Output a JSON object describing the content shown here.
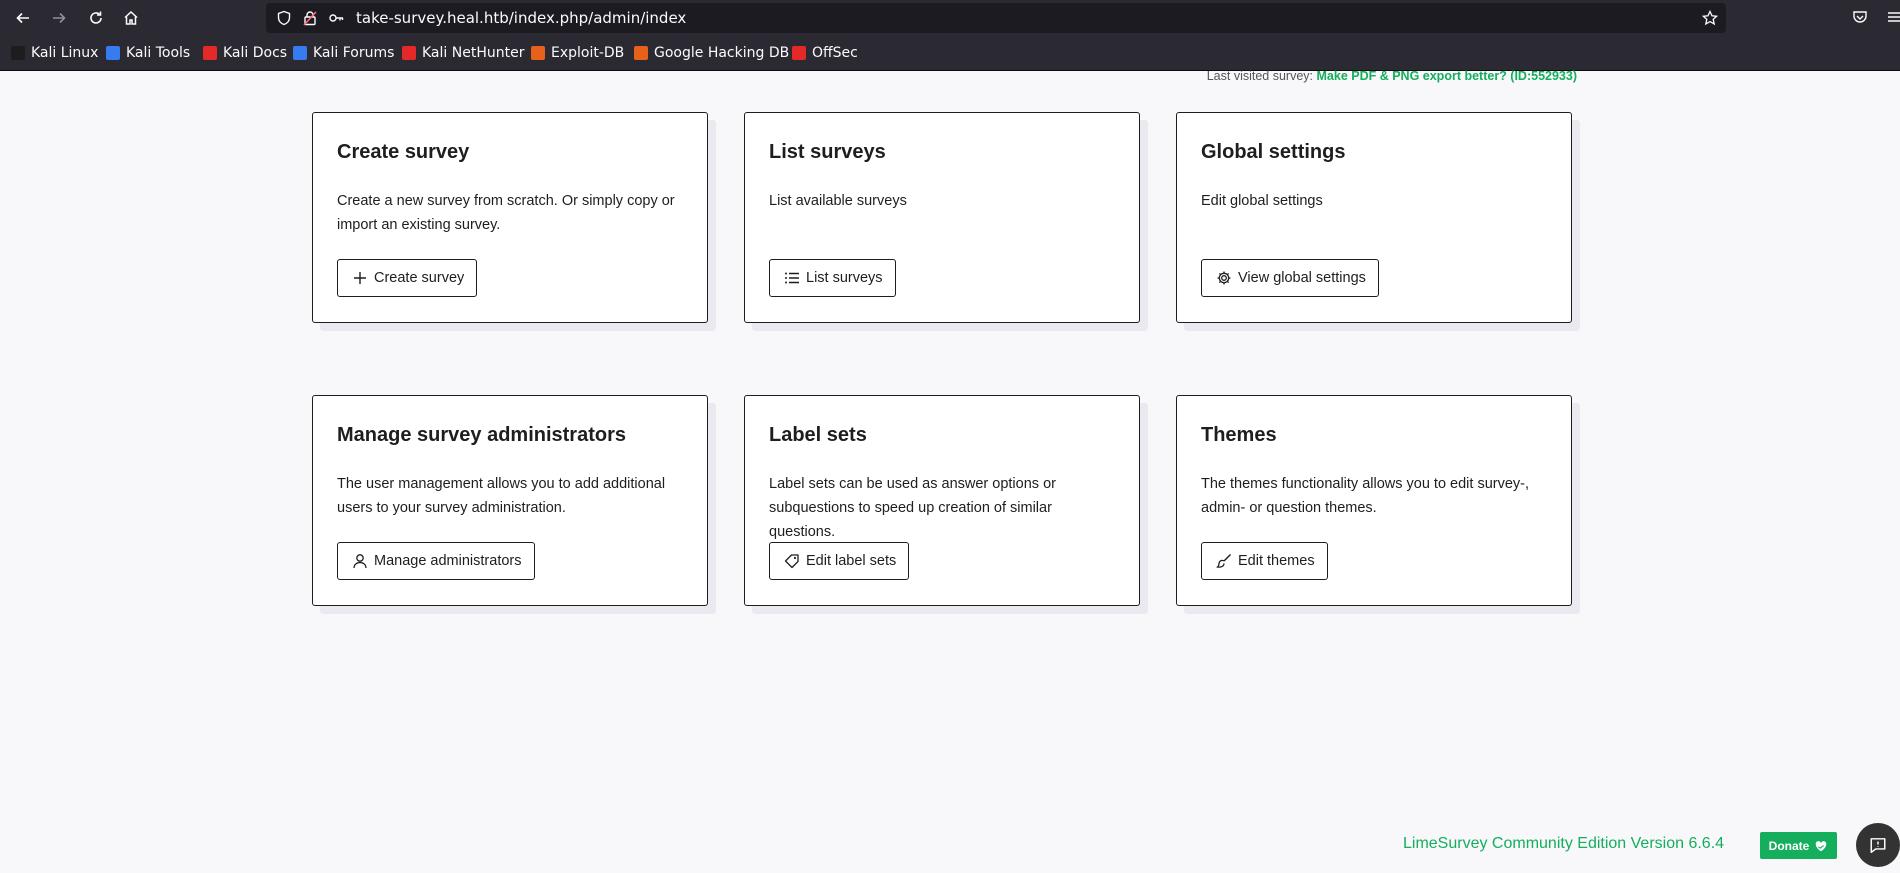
{
  "browser": {
    "url": "take-survey.heal.htb/index.php/admin/index",
    "bookmarks": [
      {
        "label": "Kali Linux",
        "color": "#1d1d1d"
      },
      {
        "label": "Kali Tools",
        "color": "#367bf0"
      },
      {
        "label": "Kali Docs",
        "color": "#e52929"
      },
      {
        "label": "Kali Forums",
        "color": "#367bf0"
      },
      {
        "label": "Kali NetHunter",
        "color": "#e52929"
      },
      {
        "label": "Exploit-DB",
        "color": "#e8611a"
      },
      {
        "label": "Google Hacking DB",
        "color": "#e8611a"
      },
      {
        "label": "OffSec",
        "color": "#e52929"
      }
    ]
  },
  "header": {
    "last_visited_label": "Last visited survey:",
    "last_visited_link": "Make PDF & PNG export better? (ID:552933)"
  },
  "cards": [
    {
      "title": "Create survey",
      "description": "Create a new survey from scratch. Or simply copy or import an existing survey.",
      "button": "Create survey",
      "icon": "plus-icon"
    },
    {
      "title": "List surveys",
      "description": "List available surveys",
      "button": "List surveys",
      "icon": "list-icon"
    },
    {
      "title": "Global settings",
      "description": "Edit global settings",
      "button": "View global settings",
      "icon": "gear-icon"
    },
    {
      "title": "Manage survey administrators",
      "description": "The user management allows you to add additional users to your survey administration.",
      "button": "Manage administrators",
      "icon": "user-icon"
    },
    {
      "title": "Label sets",
      "description": "Label sets can be used as answer options or subquestions to speed up creation of similar questions.",
      "button": "Edit label sets",
      "icon": "tag-icon"
    },
    {
      "title": "Themes",
      "description": "The themes functionality allows you to edit survey-, admin- or question themes.",
      "button": "Edit themes",
      "icon": "brush-icon"
    }
  ],
  "footer": {
    "version": "LimeSurvey Community Edition Version 6.6.4",
    "donate": "Donate"
  },
  "colors": {
    "accent": "#14ae5c",
    "browser_bg": "#2b2a33",
    "page_bg": "#f8f8fb"
  }
}
